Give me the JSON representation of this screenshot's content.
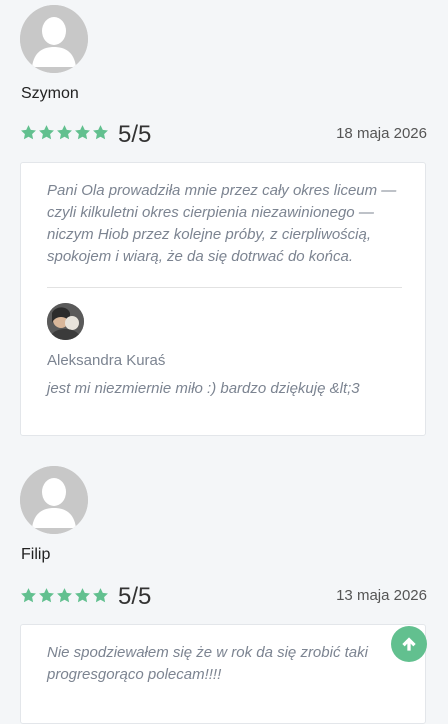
{
  "reviews": [
    {
      "name": "Szymon",
      "score": "5/5",
      "date": "18 maja 2026",
      "text": "Pani Ola prowadziła mnie przez cały okres liceum — czyli kilkuletni okres cierpienia niezawinionego — niczym Hiob przez kolejne próby, z cierpliwością, spokojem i wiarą, że da się dotrwać do końca.",
      "reply": {
        "name": "Aleksandra Kuraś",
        "text": "jest mi niezmiernie miło :) bardzo dziękuję &lt;3"
      }
    },
    {
      "name": "Filip",
      "score": "5/5",
      "date": "13 maja 2026",
      "text": "Nie spodziewałem się że w rok da się zrobić taki progresgorąco polecam!!!!"
    }
  ],
  "colors": {
    "star": "#62c08f",
    "scroll_button": "#62c08f"
  },
  "icons": {
    "avatar": "user-placeholder-icon",
    "star": "star-icon",
    "scroll_top": "arrow-up-icon"
  }
}
